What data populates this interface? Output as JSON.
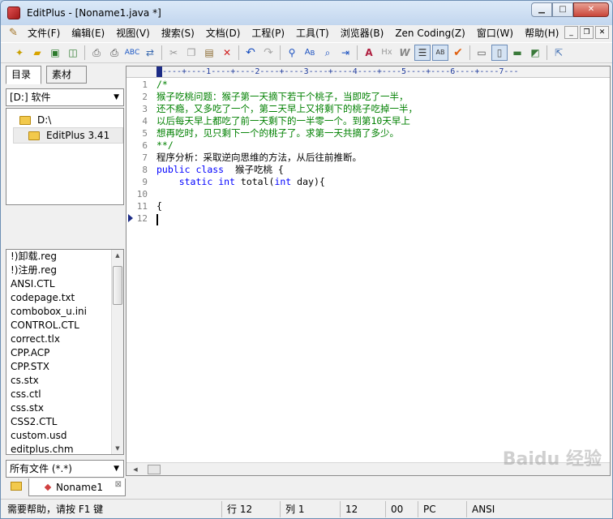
{
  "window": {
    "title": "EditPlus - [Noname1.java *]"
  },
  "menu": [
    "文件(F)",
    "编辑(E)",
    "视图(V)",
    "搜索(S)",
    "文档(D)",
    "工程(P)",
    "工具(T)",
    "浏览器(B)",
    "Zen Coding(Z)",
    "窗口(W)",
    "帮助(H)"
  ],
  "toolbar_icons": [
    "new-file-icon",
    "open-folder-icon",
    "save-icon",
    "save-all-icon",
    "print-preview-icon",
    "print-icon",
    "spell-check-icon",
    "ftp-icon",
    "cut-icon",
    "copy-icon",
    "paste-icon",
    "delete-icon",
    "undo-icon",
    "redo-icon",
    "find-icon",
    "replace-icon",
    "find-in-files-icon",
    "goto-icon",
    "font-icon",
    "hex-icon",
    "word-wrap-icon",
    "line-number-icon",
    "ruler-icon",
    "check-icon",
    "cliptext-icon",
    "directory-icon",
    "output-icon",
    "browser-icon",
    "help-icon"
  ],
  "left": {
    "tab_dir": "目录",
    "tab_clip": "素材",
    "drive": "[D:] 软件",
    "dirs": [
      "D:\\",
      "EditPlus 3.41"
    ],
    "files": [
      "!)卸载.reg",
      "!)注册.reg",
      "ANSI.CTL",
      "codepage.txt",
      "combobox_u.ini",
      "CONTROL.CTL",
      "correct.tlx",
      "CPP.ACP",
      "CPP.STX",
      "cs.stx",
      "css.ctl",
      "css.stx",
      "CSS2.CTL",
      "custom.usd",
      "editplus.chm"
    ],
    "filter": "所有文件 (*.*)"
  },
  "editor": {
    "ruler": "----+----1----+----2----+----3----+----4----+----5----+----6----+----7---",
    "line_numbers": [
      "1",
      "2",
      "3",
      "4",
      "5",
      "6",
      "7",
      "8",
      "9",
      "10",
      "11",
      "12"
    ],
    "lines": [
      "/*",
      "猴子吃桃问题：猴子第一天摘下若干个桃子，当即吃了一半，",
      "还不瘾，又多吃了一个，第二天早上又将剩下的桃子吃掉一半，",
      "以后每天早上都吃了前一天剩下的一半零一个。到第10天早上",
      "想再吃时，见只剩下一个的桃子了。求第一天共摘了多少。",
      "**/",
      "程序分析：采取逆向思维的方法，从后往前推断。",
      "",
      "",
      "",
      "{",
      ""
    ],
    "line8": {
      "kw1": "public",
      "kw2": "class",
      "rest": "猴子吃桃 {"
    },
    "line9": {
      "kw1": "static",
      "kw2": "int",
      "mid": "total(",
      "kw3": "int",
      "rest": "day){"
    },
    "watermark": "Baidu 经验"
  },
  "doc_tab": "Noname1",
  "status": {
    "help": "需要帮助，请按 F1 键",
    "row": "行 12",
    "col": "列 1",
    "f3": "12",
    "f4": "00",
    "f5": "PC",
    "f6": "ANSI"
  }
}
